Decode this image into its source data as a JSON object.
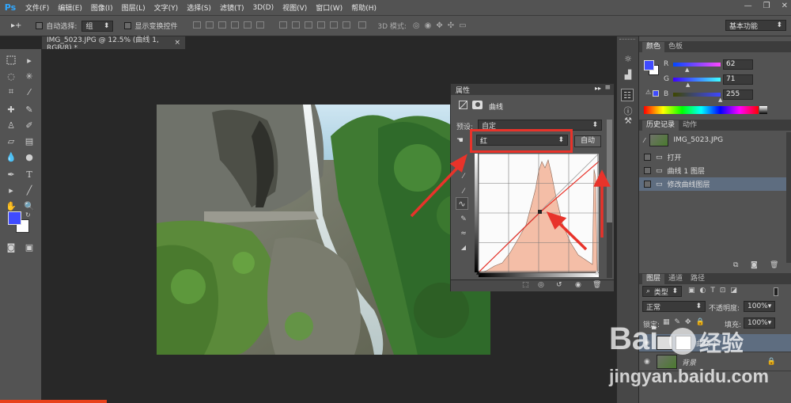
{
  "app_logo": "Ps",
  "menu": [
    "文件(F)",
    "编辑(E)",
    "图像(I)",
    "图层(L)",
    "文字(Y)",
    "选择(S)",
    "滤镜(T)",
    "3D(D)",
    "视图(V)",
    "窗口(W)",
    "帮助(H)"
  ],
  "window_controls": {
    "minimize": "—",
    "restore": "❐",
    "close": "✕"
  },
  "options_bar": {
    "auto_select_label": "自动选择:",
    "auto_select_value": "组",
    "show_transform_label": "显示变换控件",
    "mode_3d_label": "3D 模式:",
    "workspace": "基本功能"
  },
  "document_tab": {
    "title": "IMG_5023.JPG @ 12.5% (曲线 1, RGB/8) *",
    "close": "×"
  },
  "colors": {
    "foreground": "#3f4bff",
    "background": "#ffffff",
    "accent_red": "#e8332a",
    "panel_bg": "#535353",
    "curve_fill": "#f4bea7"
  },
  "properties_panel": {
    "tab": "属性",
    "title": "曲线",
    "preset_label": "预设:",
    "preset_value": "自定",
    "channel_value": "红",
    "auto_button": "自动"
  },
  "color_panel": {
    "tabs": [
      "颜色",
      "色板"
    ],
    "channels": [
      {
        "label": "R",
        "value": "62",
        "fraction": 0.243
      },
      {
        "label": "G",
        "value": "71",
        "fraction": 0.278
      },
      {
        "label": "B",
        "value": "255",
        "fraction": 1.0
      }
    ]
  },
  "history_panel": {
    "tabs": [
      "历史记录",
      "动作"
    ],
    "snapshot": "IMG_5023.JPG",
    "items": [
      "打开",
      "曲线 1 图层",
      "修改曲线图层"
    ]
  },
  "layers_panel": {
    "tabs": [
      "图层",
      "通道",
      "路径"
    ],
    "filter_value": "类型",
    "blend_mode": "正常",
    "opacity_label": "不透明度:",
    "opacity_value": "100%",
    "lock_label": "锁定:",
    "fill_label": "填充:",
    "fill_value": "100%",
    "layers": [
      "曲线 1",
      "背景"
    ]
  },
  "watermark": {
    "brand": "Bai",
    "brand_suffix": "经验",
    "url": "jingyan.baidu.com"
  }
}
